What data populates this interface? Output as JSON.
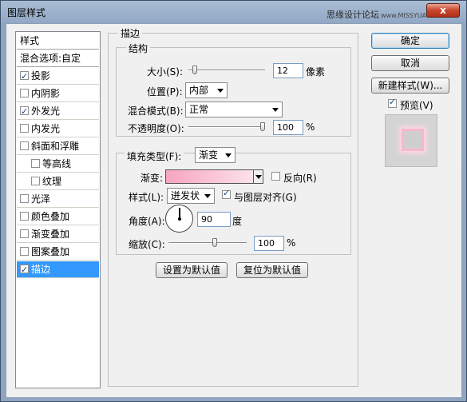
{
  "window": {
    "title": "图层样式",
    "watermark": "思缘设计论坛",
    "watermark_small": "www.MISSYUAN.COM",
    "close_label": "x"
  },
  "style_list": {
    "header": "样式",
    "blend_options": "混合选项:自定",
    "items": [
      {
        "label": "投影",
        "checked": true
      },
      {
        "label": "内阴影",
        "checked": false
      },
      {
        "label": "外发光",
        "checked": true
      },
      {
        "label": "内发光",
        "checked": false
      },
      {
        "label": "斜面和浮雕",
        "checked": false
      },
      {
        "label": "等高线",
        "checked": false
      },
      {
        "label": "纹理",
        "checked": false
      },
      {
        "label": "光泽",
        "checked": false
      },
      {
        "label": "颜色叠加",
        "checked": false
      },
      {
        "label": "渐变叠加",
        "checked": false
      },
      {
        "label": "图案叠加",
        "checked": false
      },
      {
        "label": "描边",
        "checked": true
      }
    ]
  },
  "stroke": {
    "title": "描边",
    "structure": {
      "title": "结构",
      "size_label": "大小(S):",
      "size_value": "12",
      "size_unit": "像素",
      "size_fraction": 0.05,
      "position_label": "位置(P):",
      "position_value": "内部",
      "blend_label": "混合模式(B):",
      "blend_value": "正常",
      "opacity_label": "不透明度(O):",
      "opacity_value": "100",
      "opacity_unit": "%",
      "opacity_fraction": 1.0
    },
    "fill": {
      "type_label": "填充类型(F):",
      "type_value": "渐变",
      "gradient_label": "渐变:",
      "reverse_label": "反向(R)",
      "style_label": "样式(L):",
      "style_value": "迸发状",
      "align_label": "与图层对齐(G)",
      "angle_label": "角度(A):",
      "angle_value": "90",
      "angle_unit": "度",
      "scale_label": "缩放(C):",
      "scale_value": "100",
      "scale_unit": "%",
      "scale_fraction": 0.6
    },
    "set_default": "设置为默认值",
    "reset_default": "复位为默认值"
  },
  "buttons": {
    "ok": "确定",
    "cancel": "取消",
    "new_style": "新建样式(W)...",
    "preview": "预览(V)"
  },
  "colors": {
    "accent": "#3399ff",
    "stroke_gradient_start": "#f6a5bf",
    "stroke_gradient_end": "#fde8ef"
  }
}
